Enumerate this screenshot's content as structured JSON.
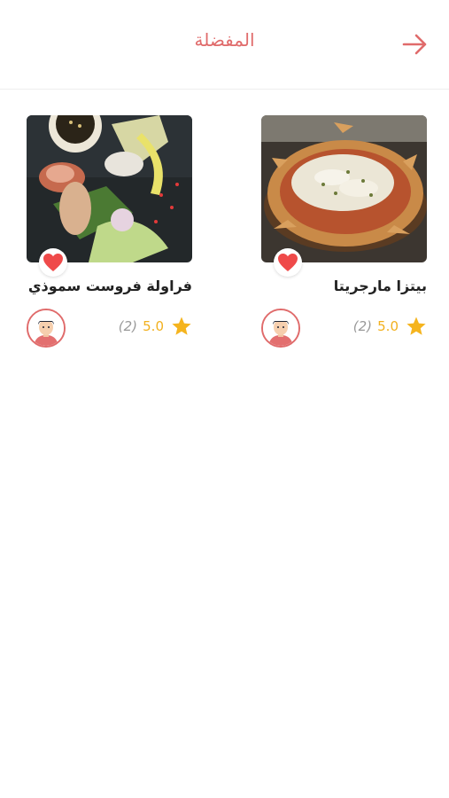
{
  "header": {
    "title": "المفضلة",
    "back_icon": "arrow-right-icon",
    "accent_color": "#e06b6b"
  },
  "favorites": [
    {
      "title": "بيتزا مارجريتا",
      "rating": "5.0",
      "rating_count": "(2)",
      "image": "pizza-photo",
      "favorited": true
    },
    {
      "title": "فراولة فروست سموذي",
      "rating": "5.0",
      "rating_count": "(2)",
      "image": "food-rolls-photo",
      "favorited": true
    }
  ],
  "colors": {
    "heart": "#ef4a4a",
    "star": "#f5b41e",
    "rating_count": "#999999"
  }
}
